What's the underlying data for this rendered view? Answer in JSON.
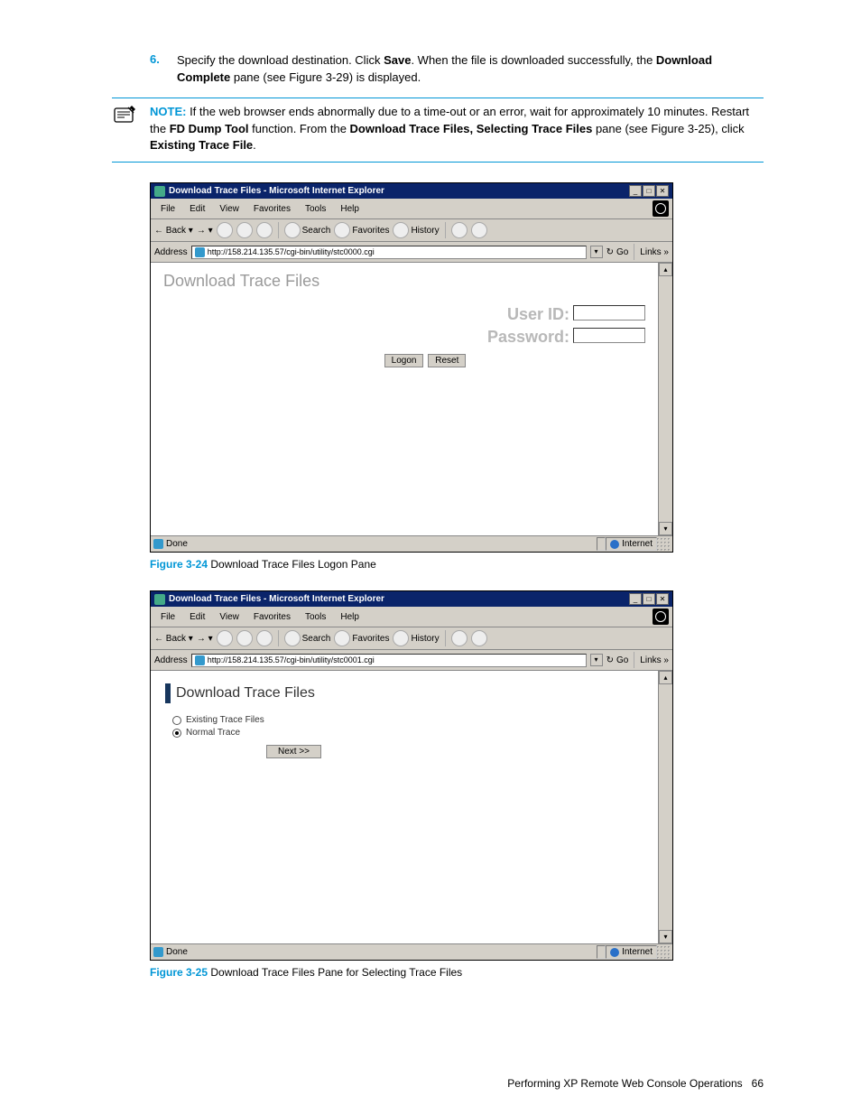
{
  "step6": {
    "num": "6.",
    "text_a": "Specify the download destination. Click ",
    "save": "Save",
    "text_b": ". When the file is downloaded successfully, the ",
    "dc": "Download Complete",
    "text_c": " pane (see Figure 3-29) is displayed."
  },
  "note": {
    "label": "NOTE:",
    "a": "  If the web browser ends abnormally due to a time-out or an error, wait for approximately 10 minutes. Restart the ",
    "b": "FD Dump Tool",
    "c": " function. From the ",
    "d": "Download Trace Files, Selecting Trace Files",
    "e": " pane (see Figure 3-25), click ",
    "f": "Existing Trace File",
    "g": "."
  },
  "ie": {
    "title": "Download Trace Files - Microsoft Internet Explorer",
    "menu": {
      "file": "File",
      "edit": "Edit",
      "view": "View",
      "fav": "Favorites",
      "tools": "Tools",
      "help": "Help"
    },
    "tool": {
      "back": "Back",
      "search": "Search",
      "fav": "Favorites",
      "hist": "History"
    },
    "addr_label": "Address",
    "go": "Go",
    "links": "Links",
    "status_done": "Done",
    "status_zone": "Internet"
  },
  "fig1": {
    "url": "http://158.214.135.57/cgi-bin/utility/stc0000.cgi",
    "page_title": "Download Trace Files",
    "userid": "User ID:",
    "password": "Password:",
    "logon": "Logon",
    "reset": "Reset",
    "caption_label": "Figure 3-24",
    "caption": " Download Trace Files Logon Pane"
  },
  "fig2": {
    "url": "http://158.214.135.57/cgi-bin/utility/stc0001.cgi",
    "page_title": "Download Trace Files",
    "opt1": "Existing Trace Files",
    "opt2": "Normal Trace",
    "next": "Next >>",
    "caption_label": "Figure 3-25",
    "caption": " Download Trace Files Pane for Selecting Trace Files"
  },
  "footer": {
    "text": "Performing XP Remote Web Console Operations",
    "page": "66"
  }
}
